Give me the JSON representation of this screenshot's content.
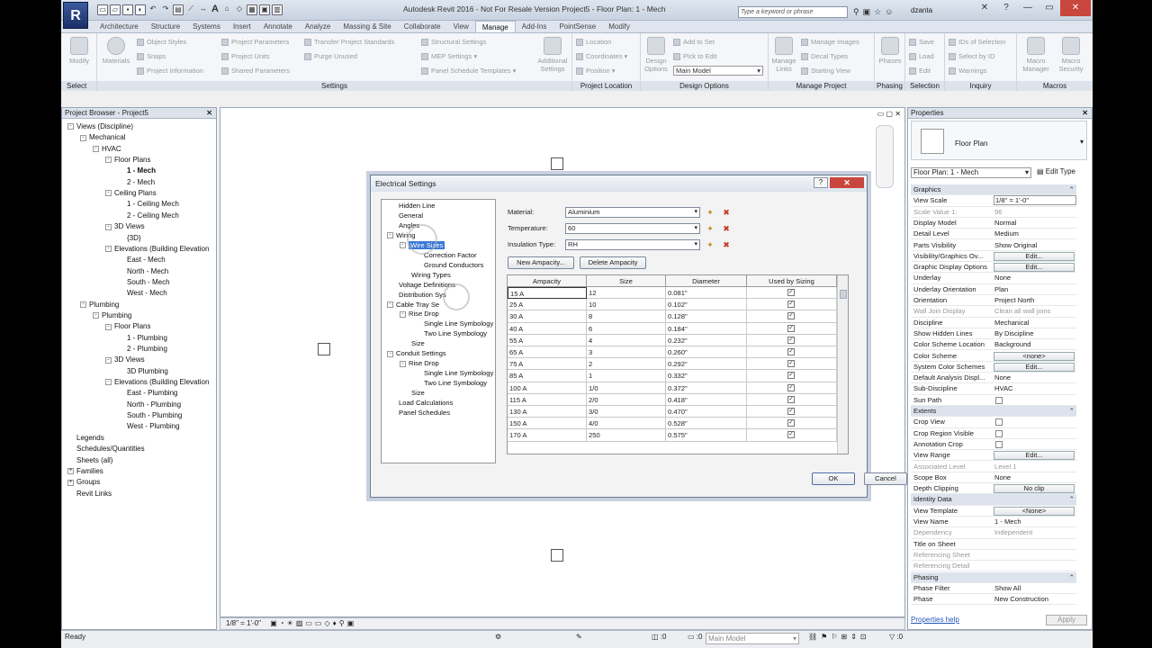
{
  "app": {
    "logo": "R",
    "title": "Autodesk Revit 2016 - Not For Resale Version    Project5 - Floor Plan: 1 - Mech",
    "search_placeholder": "Type a keyword or phrase",
    "user": "dzanta",
    "icons": [
      "open-icon",
      "save-icon",
      "undo-icon",
      "redo-icon",
      "print-icon",
      "measure-icon",
      "text-icon",
      "3d-icon",
      "section-icon"
    ]
  },
  "tabs": [
    "Architecture",
    "Structure",
    "Systems",
    "Insert",
    "Annotate",
    "Analyze",
    "Massing & Site",
    "Collaborate",
    "View",
    "Manage",
    "Add-Ins",
    "PointSense",
    "Modify"
  ],
  "active_tab": "Manage",
  "ribbon": {
    "select": {
      "modify": "Modify",
      "label": "Select"
    },
    "settings": {
      "materials": "Materials",
      "object_styles": "Object Styles",
      "snaps": "Snaps",
      "project_information": "Project Information",
      "project_parameters": "Project Parameters",
      "project_units": "Project Units",
      "shared_parameters": "Shared Parameters",
      "transfer_project_standards": "Transfer Project Standards",
      "purge_unused": "Purge Unused",
      "structural_settings": "Structural Settings",
      "mep_settings": "MEP Settings",
      "panel_schedule_templates": "Panel Schedule  Templates",
      "additional_settings": "Additional Settings",
      "label": "Settings"
    },
    "project_location": {
      "location": "Location",
      "coordinates": "Coordinates",
      "position": "Position",
      "label": "Project Location"
    },
    "design_options": {
      "design_options": "Design Options",
      "add_to_set": "Add to Set",
      "pick_to_edit": "Pick to Edit",
      "main_model": "Main Model",
      "label": "Design Options"
    },
    "manage_project": {
      "manage_links": "Manage Links",
      "manage_images": "Manage Images",
      "decal_types": "Decal Types",
      "starting_view": "Starting View",
      "label": "Manage Project"
    },
    "phasing": {
      "phases": "Phases",
      "label": "Phasing"
    },
    "selection": {
      "save": "Save",
      "load": "Load",
      "edit": "Edit",
      "label": "Selection"
    },
    "inquiry": {
      "ids_of_selection": "IDs of Selection",
      "select_by_id": "Select by ID",
      "warnings": "Warnings",
      "label": "Inquiry"
    },
    "macros": {
      "macro_manager": "Macro Manager",
      "macro_security": "Macro Security",
      "label": "Macros"
    }
  },
  "browser": {
    "title": "Project Browser - Project5",
    "items": [
      {
        "label": "Views (Discipline)",
        "level": 0,
        "exp": "-"
      },
      {
        "label": "Mechanical",
        "level": 1,
        "exp": "-"
      },
      {
        "label": "HVAC",
        "level": 2,
        "exp": "-"
      },
      {
        "label": "Floor Plans",
        "level": 3,
        "exp": "-"
      },
      {
        "label": "1 - Mech",
        "level": 4,
        "bold": true
      },
      {
        "label": "2 - Mech",
        "level": 4
      },
      {
        "label": "Ceiling Plans",
        "level": 3,
        "exp": "-"
      },
      {
        "label": "1 - Ceiling Mech",
        "level": 4
      },
      {
        "label": "2 - Ceiling Mech",
        "level": 4
      },
      {
        "label": "3D Views",
        "level": 3,
        "exp": "-"
      },
      {
        "label": "{3D}",
        "level": 4
      },
      {
        "label": "Elevations (Building Elevation",
        "level": 3,
        "exp": "-"
      },
      {
        "label": "East - Mech",
        "level": 4
      },
      {
        "label": "North - Mech",
        "level": 4
      },
      {
        "label": "South - Mech",
        "level": 4
      },
      {
        "label": "West - Mech",
        "level": 4
      },
      {
        "label": "Plumbing",
        "level": 1,
        "exp": "-"
      },
      {
        "label": "Plumbing",
        "level": 2,
        "exp": "-"
      },
      {
        "label": "Floor Plans",
        "level": 3,
        "exp": "-"
      },
      {
        "label": "1 - Plumbing",
        "level": 4
      },
      {
        "label": "2 - Plumbing",
        "level": 4
      },
      {
        "label": "3D Views",
        "level": 3,
        "exp": "-"
      },
      {
        "label": "3D Plumbing",
        "level": 4
      },
      {
        "label": "Elevations (Building Elevation",
        "level": 3,
        "exp": "-"
      },
      {
        "label": "East - Plumbing",
        "level": 4
      },
      {
        "label": "North - Plumbing",
        "level": 4
      },
      {
        "label": "South - Plumbing",
        "level": 4
      },
      {
        "label": "West - Plumbing",
        "level": 4
      },
      {
        "label": "Legends",
        "level": 0
      },
      {
        "label": "Schedules/Quantities",
        "level": 0
      },
      {
        "label": "Sheets (all)",
        "level": 0
      },
      {
        "label": "Families",
        "level": 0,
        "exp": "+"
      },
      {
        "label": "Groups",
        "level": 0,
        "exp": "+"
      },
      {
        "label": "Revit Links",
        "level": 0
      }
    ]
  },
  "viewbar": {
    "scale": "1/8\" = 1'-0\""
  },
  "status": {
    "text": "Ready",
    "zero1": ":0",
    "zero2": ":0",
    "model": "Main Model",
    "zero3": ":0"
  },
  "properties": {
    "title": "Properties",
    "type_label": "Floor Plan",
    "instance_selector": "Floor Plan: 1 - Mech",
    "edit_type": "Edit Type",
    "rows": [
      {
        "n": "Graphics",
        "section": true
      },
      {
        "n": "View Scale",
        "v": "1/8\" = 1'-0\""
      },
      {
        "n": "Scale Value    1:",
        "v": "96",
        "grey": true
      },
      {
        "n": "Display Model",
        "v": "Normal"
      },
      {
        "n": "Detail Level",
        "v": "Medium"
      },
      {
        "n": "Parts Visibility",
        "v": "Show Original"
      },
      {
        "n": "Visibility/Graphics Ov...",
        "btn": "Edit..."
      },
      {
        "n": "Graphic Display Options",
        "btn": "Edit..."
      },
      {
        "n": "Underlay",
        "v": "None"
      },
      {
        "n": "Underlay Orientation",
        "v": "Plan"
      },
      {
        "n": "Orientation",
        "v": "Project North"
      },
      {
        "n": "Wall Join Display",
        "v": "Clean all wall joins",
        "grey": true
      },
      {
        "n": "Discipline",
        "v": "Mechanical"
      },
      {
        "n": "Show Hidden Lines",
        "v": "By Discipline"
      },
      {
        "n": "Color Scheme Location",
        "v": "Background"
      },
      {
        "n": "Color Scheme",
        "btn": "<none>"
      },
      {
        "n": "System Color Schemes",
        "btn": "Edit..."
      },
      {
        "n": "Default Analysis Displ...",
        "v": "None"
      },
      {
        "n": "Sub-Discipline",
        "v": "HVAC"
      },
      {
        "n": "Sun Path",
        "chk": true
      },
      {
        "n": "Extents",
        "section": true
      },
      {
        "n": "Crop View",
        "chk": true
      },
      {
        "n": "Crop Region Visible",
        "chk": true
      },
      {
        "n": "Annotation Crop",
        "chk": true
      },
      {
        "n": "View Range",
        "btn": "Edit..."
      },
      {
        "n": "Associated Level",
        "v": "Level 1",
        "grey": true
      },
      {
        "n": "Scope Box",
        "v": "None"
      },
      {
        "n": "Depth Clipping",
        "btn": "No clip"
      },
      {
        "n": "Identity Data",
        "section": true
      },
      {
        "n": "View Template",
        "btn": "<None>"
      },
      {
        "n": "View Name",
        "v": "1 - Mech"
      },
      {
        "n": "Dependency",
        "v": "Independent",
        "grey": true
      },
      {
        "n": "Title on Sheet",
        "v": ""
      },
      {
        "n": "Referencing Sheet",
        "v": "",
        "grey": true
      },
      {
        "n": "Referencing Detail",
        "v": "",
        "grey": true
      },
      {
        "n": "Phasing",
        "section": true
      },
      {
        "n": "Phase Filter",
        "v": "Show All"
      },
      {
        "n": "Phase",
        "v": "New Construction"
      }
    ],
    "help": "Properties help",
    "apply": "Apply"
  },
  "dialog": {
    "title": "Electrical Settings",
    "help": "?",
    "tree": [
      {
        "label": "Hidden Line",
        "level": 0
      },
      {
        "label": "General",
        "level": 0
      },
      {
        "label": "Angles",
        "level": 0
      },
      {
        "label": "Wiring",
        "level": 0,
        "exp": "-"
      },
      {
        "label": "Wire Sizes",
        "level": 1,
        "exp": "-",
        "selected": true
      },
      {
        "label": "Correction Factor",
        "level": 2
      },
      {
        "label": "Ground Conductors",
        "level": 2
      },
      {
        "label": "Wiring Types",
        "level": 1
      },
      {
        "label": "Voltage Definitions",
        "level": 0
      },
      {
        "label": "Distribution Sys",
        "level": 0
      },
      {
        "label": "Cable Tray Se",
        "level": 0,
        "exp": "-"
      },
      {
        "label": "Rise Drop",
        "level": 1,
        "exp": "-"
      },
      {
        "label": "Single Line Symbology",
        "level": 2
      },
      {
        "label": "Two Line Symbology",
        "level": 2
      },
      {
        "label": "Size",
        "level": 1
      },
      {
        "label": "Conduit Settings",
        "level": 0,
        "exp": "-"
      },
      {
        "label": "Rise Drop",
        "level": 1,
        "exp": "-"
      },
      {
        "label": "Single Line Symbology",
        "level": 2
      },
      {
        "label": "Two Line Symbology",
        "level": 2
      },
      {
        "label": "Size",
        "level": 1
      },
      {
        "label": "Load Calculations",
        "level": 0
      },
      {
        "label": "Panel Schedules",
        "level": 0
      }
    ],
    "material_label": "Material:",
    "material_value": "Aluminium",
    "temperature_label": "Temperature:",
    "temperature_value": "60",
    "insulation_label": "Insulation Type:",
    "insulation_value": "RH",
    "new_ampacity": "New Ampacity...",
    "delete_ampacity": "Delete Ampacity",
    "columns": [
      "Ampacity",
      "Size",
      "Diameter",
      "Used by Sizing"
    ],
    "rows": [
      [
        "15 A",
        "12",
        "0.081\""
      ],
      [
        "25 A",
        "10",
        "0.102\""
      ],
      [
        "30 A",
        "8",
        "0.128\""
      ],
      [
        "40 A",
        "6",
        "0.184\""
      ],
      [
        "55 A",
        "4",
        "0.232\""
      ],
      [
        "65 A",
        "3",
        "0.260\""
      ],
      [
        "75 A",
        "2",
        "0.292\""
      ],
      [
        "85 A",
        "1",
        "0.332\""
      ],
      [
        "100 A",
        "1/0",
        "0.372\""
      ],
      [
        "115 A",
        "2/0",
        "0.418\""
      ],
      [
        "130 A",
        "3/0",
        "0.470\""
      ],
      [
        "150 A",
        "4/0",
        "0.528\""
      ],
      [
        "170 A",
        "250",
        "0.575\""
      ]
    ],
    "check_mark": "✓",
    "ok": "OK",
    "cancel": "Cancel"
  }
}
